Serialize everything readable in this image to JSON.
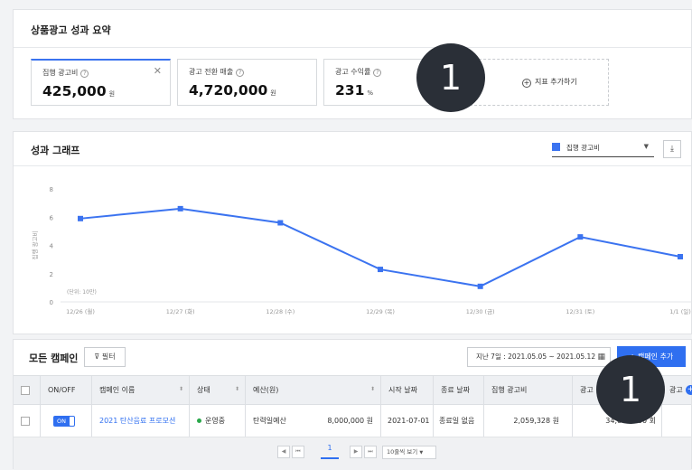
{
  "summary": {
    "title": "상품광고 성과 요약",
    "cards": [
      {
        "label": "집행 광고비",
        "value": "425,000",
        "unit": "원",
        "active": true
      },
      {
        "label": "광고 전환 매출",
        "value": "4,720,000",
        "unit": "원"
      },
      {
        "label": "광고 수익률",
        "value": "231",
        "unit": "%"
      }
    ],
    "add_metric_label": "지표 추가하기"
  },
  "graph": {
    "title": "성과 그래프",
    "metric_selected": "집행 광고비",
    "series_color": "#3b73f0"
  },
  "chart_data": {
    "type": "line",
    "categories": [
      "12/26 (월)",
      "12/27 (화)",
      "12/28 (수)",
      "12/29 (목)",
      "12/30 (금)",
      "12/31 (토)",
      "1/1 (일)"
    ],
    "series": [
      {
        "name": "집행 광고비",
        "values": [
          5.9,
          6.6,
          5.6,
          2.3,
          1.1,
          4.6,
          3.2
        ]
      }
    ],
    "y_ticks": [
      "0",
      "2",
      "4",
      "6",
      "8"
    ],
    "ylim": [
      0,
      8
    ],
    "ylabel": "집행 광고비",
    "unit_note": "(단위: 10만)",
    "grid": false
  },
  "campaigns": {
    "title": "모든 캠페인",
    "filter_label": "필터",
    "date_range": "지난 7일 : 2021.05.05 ~ 2021.05.12",
    "add_button": "캠페인 추가",
    "columns": [
      "ON/OFF",
      "캠페인 이름",
      "상태",
      "예산(원)",
      "시작 날짜",
      "종료 날짜",
      "집행 광고비",
      "광고",
      "광고"
    ],
    "rows": [
      {
        "toggle": "ON",
        "name": "2021 탄산음료 프로모션",
        "status": "운영중",
        "budget_type": "탄력일예산",
        "budget": "8,000,000 원",
        "start": "2021-07-01",
        "end": "종료일 없음",
        "spend": "2,059,328 원",
        "impressions": "34,000,000 회"
      }
    ],
    "page": "1",
    "page_size": "10줄씩 보기"
  },
  "markers": [
    "1",
    "1"
  ]
}
